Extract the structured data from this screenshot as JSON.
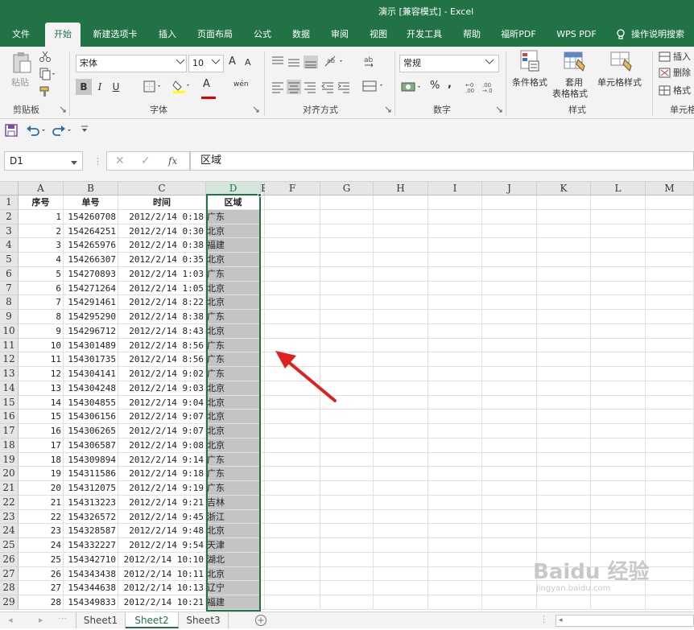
{
  "window": {
    "title": "演示 [兼容模式] - Excel"
  },
  "tabs": [
    "文件",
    "开始",
    "新建选项卡",
    "插入",
    "页面布局",
    "公式",
    "数据",
    "审阅",
    "视图",
    "开发工具",
    "帮助",
    "福昕PDF",
    "WPS PDF",
    "操作说明搜索"
  ],
  "ribbon": {
    "clipboard": {
      "paste": "粘贴",
      "label": "剪贴板"
    },
    "font": {
      "name": "宋体",
      "size": "10",
      "label": "字体",
      "bold": "B",
      "italic": "I",
      "underline": "U",
      "grow": "A",
      "shrink": "A",
      "font_color": "A",
      "wen": "wén"
    },
    "alignment": {
      "label": "对齐方式"
    },
    "number": {
      "format": "常规",
      "label": "数字",
      "percent": "%",
      "comma": ","
    },
    "styles": {
      "conditional": "条件格式",
      "table1": "套用",
      "table2": "表格格式",
      "cell_styles": "单元格样式",
      "label": "样式"
    },
    "cells": {
      "insert": "插入",
      "delete": "删除",
      "format": "格式",
      "label": "单元格"
    }
  },
  "formula_bar": {
    "name_box": "D1",
    "fx": "fx",
    "content": "区域"
  },
  "columns": [
    "A",
    "B",
    "C",
    "D",
    "E",
    "F",
    "G",
    "H",
    "I",
    "J",
    "K",
    "L",
    "M"
  ],
  "headers": {
    "a": "序号",
    "b": "单号",
    "c": "时间",
    "d": "区域"
  },
  "rows": [
    [
      "1",
      "154260708",
      "2012/2/14 0:18",
      "广东"
    ],
    [
      "2",
      "154264251",
      "2012/2/14 0:30",
      "北京"
    ],
    [
      "3",
      "154265976",
      "2012/2/14 0:38",
      "福建"
    ],
    [
      "4",
      "154266307",
      "2012/2/14 0:35",
      "北京"
    ],
    [
      "5",
      "154270893",
      "2012/2/14 1:03",
      "广东"
    ],
    [
      "6",
      "154271264",
      "2012/2/14 1:05",
      "北京"
    ],
    [
      "7",
      "154291461",
      "2012/2/14 8:22",
      "北京"
    ],
    [
      "8",
      "154295290",
      "2012/2/14 8:38",
      "广东"
    ],
    [
      "9",
      "154296712",
      "2012/2/14 8:43",
      "北京"
    ],
    [
      "10",
      "154301489",
      "2012/2/14 8:56",
      "广东"
    ],
    [
      "11",
      "154301735",
      "2012/2/14 8:56",
      "广东"
    ],
    [
      "12",
      "154304141",
      "2012/2/14 9:02",
      "广东"
    ],
    [
      "13",
      "154304248",
      "2012/2/14 9:03",
      "北京"
    ],
    [
      "14",
      "154304855",
      "2012/2/14 9:04",
      "北京"
    ],
    [
      "15",
      "154306156",
      "2012/2/14 9:07",
      "北京"
    ],
    [
      "16",
      "154306265",
      "2012/2/14 9:07",
      "北京"
    ],
    [
      "17",
      "154306587",
      "2012/2/14 9:08",
      "北京"
    ],
    [
      "18",
      "154309894",
      "2012/2/14 9:14",
      "广东"
    ],
    [
      "19",
      "154311586",
      "2012/2/14 9:18",
      "广东"
    ],
    [
      "20",
      "154312075",
      "2012/2/14 9:19",
      "广东"
    ],
    [
      "21",
      "154313223",
      "2012/2/14 9:21",
      "吉林"
    ],
    [
      "22",
      "154326572",
      "2012/2/14 9:45",
      "浙江"
    ],
    [
      "23",
      "154328587",
      "2012/2/14 9:48",
      "北京"
    ],
    [
      "24",
      "154332227",
      "2012/2/14 9:54",
      "天津"
    ],
    [
      "25",
      "154342710",
      "2012/2/14 10:10",
      "湖北"
    ],
    [
      "26",
      "154343438",
      "2012/2/14 10:11",
      "北京"
    ],
    [
      "27",
      "154344638",
      "2012/2/14 10:13",
      "辽宁"
    ],
    [
      "28",
      "154349833",
      "2012/2/14 10:21",
      "福建"
    ]
  ],
  "sheets": [
    "Sheet1",
    "Sheet2",
    "Sheet3"
  ],
  "watermark": {
    "brand": "Baidu 经验",
    "url": "jingyan.baidu.com"
  },
  "colors": {
    "accent": "#217346",
    "arrow": "#e02020",
    "selected_fill": "#c4c4c4"
  }
}
